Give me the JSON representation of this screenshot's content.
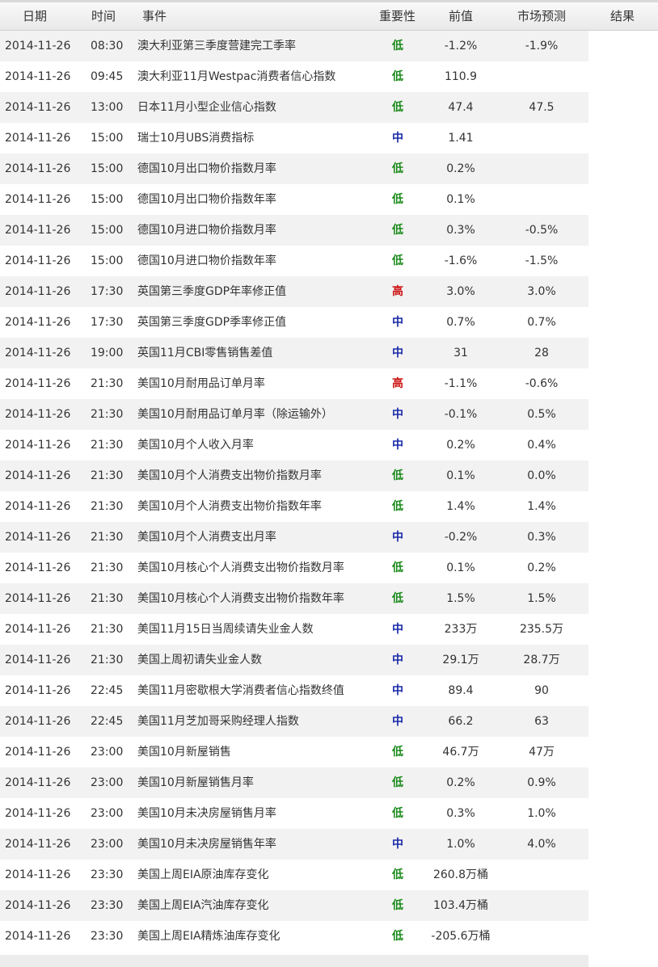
{
  "header": {
    "date": "日期",
    "time": "时间",
    "event": "事件",
    "importance": "重要性",
    "previous": "前值",
    "forecast": "市场预测",
    "result": "结果"
  },
  "colors": {
    "low": "#1a8a1a",
    "mid": "#1a2aa8",
    "high": "#cc1111"
  },
  "rows": [
    {
      "date": "2014-11-26",
      "time": "08:30",
      "event": "澳大利亚第三季度营建完工季率",
      "importance": "低",
      "level": "low",
      "previous": "-1.2%",
      "forecast": "-1.9%"
    },
    {
      "date": "2014-11-26",
      "time": "09:45",
      "event": "澳大利亚11月Westpac消费者信心指数",
      "importance": "低",
      "level": "low",
      "previous": "110.9",
      "forecast": ""
    },
    {
      "date": "2014-11-26",
      "time": "13:00",
      "event": "日本11月小型企业信心指数",
      "importance": "低",
      "level": "low",
      "previous": "47.4",
      "forecast": "47.5"
    },
    {
      "date": "2014-11-26",
      "time": "15:00",
      "event": "瑞士10月UBS消费指标",
      "importance": "中",
      "level": "mid",
      "previous": "1.41",
      "forecast": ""
    },
    {
      "date": "2014-11-26",
      "time": "15:00",
      "event": "德国10月出口物价指数月率",
      "importance": "低",
      "level": "low",
      "previous": "0.2%",
      "forecast": ""
    },
    {
      "date": "2014-11-26",
      "time": "15:00",
      "event": "德国10月出口物价指数年率",
      "importance": "低",
      "level": "low",
      "previous": "0.1%",
      "forecast": ""
    },
    {
      "date": "2014-11-26",
      "time": "15:00",
      "event": "德国10月进口物价指数月率",
      "importance": "低",
      "level": "low",
      "previous": "0.3%",
      "forecast": "-0.5%"
    },
    {
      "date": "2014-11-26",
      "time": "15:00",
      "event": "德国10月进口物价指数年率",
      "importance": "低",
      "level": "low",
      "previous": "-1.6%",
      "forecast": "-1.5%"
    },
    {
      "date": "2014-11-26",
      "time": "17:30",
      "event": "英国第三季度GDP年率修正值",
      "importance": "高",
      "level": "high",
      "previous": "3.0%",
      "forecast": "3.0%"
    },
    {
      "date": "2014-11-26",
      "time": "17:30",
      "event": "英国第三季度GDP季率修正值",
      "importance": "中",
      "level": "mid",
      "previous": "0.7%",
      "forecast": "0.7%"
    },
    {
      "date": "2014-11-26",
      "time": "19:00",
      "event": "英国11月CBI零售销售差值",
      "importance": "中",
      "level": "mid",
      "previous": "31",
      "forecast": "28"
    },
    {
      "date": "2014-11-26",
      "time": "21:30",
      "event": "美国10月耐用品订单月率",
      "importance": "高",
      "level": "high",
      "previous": "-1.1%",
      "forecast": "-0.6%"
    },
    {
      "date": "2014-11-26",
      "time": "21:30",
      "event": "美国10月耐用品订单月率（除运输外）",
      "importance": "中",
      "level": "mid",
      "previous": "-0.1%",
      "forecast": "0.5%"
    },
    {
      "date": "2014-11-26",
      "time": "21:30",
      "event": "美国10月个人收入月率",
      "importance": "中",
      "level": "mid",
      "previous": "0.2%",
      "forecast": "0.4%"
    },
    {
      "date": "2014-11-26",
      "time": "21:30",
      "event": "美国10月个人消费支出物价指数月率",
      "importance": "低",
      "level": "low",
      "previous": "0.1%",
      "forecast": "0.0%"
    },
    {
      "date": "2014-11-26",
      "time": "21:30",
      "event": "美国10月个人消费支出物价指数年率",
      "importance": "低",
      "level": "low",
      "previous": "1.4%",
      "forecast": "1.4%"
    },
    {
      "date": "2014-11-26",
      "time": "21:30",
      "event": "美国10月个人消费支出月率",
      "importance": "中",
      "level": "mid",
      "previous": "-0.2%",
      "forecast": "0.3%"
    },
    {
      "date": "2014-11-26",
      "time": "21:30",
      "event": "美国10月核心个人消费支出物价指数月率",
      "importance": "低",
      "level": "low",
      "previous": "0.1%",
      "forecast": "0.2%"
    },
    {
      "date": "2014-11-26",
      "time": "21:30",
      "event": "美国10月核心个人消费支出物价指数年率",
      "importance": "低",
      "level": "low",
      "previous": "1.5%",
      "forecast": "1.5%"
    },
    {
      "date": "2014-11-26",
      "time": "21:30",
      "event": "美国11月15日当周续请失业金人数",
      "importance": "中",
      "level": "mid",
      "previous": "233万",
      "forecast": "235.5万"
    },
    {
      "date": "2014-11-26",
      "time": "21:30",
      "event": "美国上周初请失业金人数",
      "importance": "中",
      "level": "mid",
      "previous": "29.1万",
      "forecast": "28.7万"
    },
    {
      "date": "2014-11-26",
      "time": "22:45",
      "event": "美国11月密歇根大学消费者信心指数终值",
      "importance": "中",
      "level": "mid",
      "previous": "89.4",
      "forecast": "90"
    },
    {
      "date": "2014-11-26",
      "time": "22:45",
      "event": "美国11月芝加哥采购经理人指数",
      "importance": "中",
      "level": "mid",
      "previous": "66.2",
      "forecast": "63"
    },
    {
      "date": "2014-11-26",
      "time": "23:00",
      "event": "美国10月新屋销售",
      "importance": "低",
      "level": "low",
      "previous": "46.7万",
      "forecast": "47万"
    },
    {
      "date": "2014-11-26",
      "time": "23:00",
      "event": "美国10月新屋销售月率",
      "importance": "低",
      "level": "low",
      "previous": "0.2%",
      "forecast": "0.9%"
    },
    {
      "date": "2014-11-26",
      "time": "23:00",
      "event": "美国10月未决房屋销售月率",
      "importance": "低",
      "level": "low",
      "previous": "0.3%",
      "forecast": "1.0%"
    },
    {
      "date": "2014-11-26",
      "time": "23:00",
      "event": "美国10月未决房屋销售年率",
      "importance": "中",
      "level": "mid",
      "previous": "1.0%",
      "forecast": "4.0%"
    },
    {
      "date": "2014-11-26",
      "time": "23:30",
      "event": "美国上周EIA原油库存变化",
      "importance": "低",
      "level": "low",
      "previous": "260.8万桶",
      "forecast": ""
    },
    {
      "date": "2014-11-26",
      "time": "23:30",
      "event": "美国上周EIA汽油库存变化",
      "importance": "低",
      "level": "low",
      "previous": "103.4万桶",
      "forecast": ""
    },
    {
      "date": "2014-11-26",
      "time": "23:30",
      "event": "美国上周EIA精炼油库存变化",
      "importance": "低",
      "level": "low",
      "previous": "-205.6万桶",
      "forecast": ""
    }
  ]
}
